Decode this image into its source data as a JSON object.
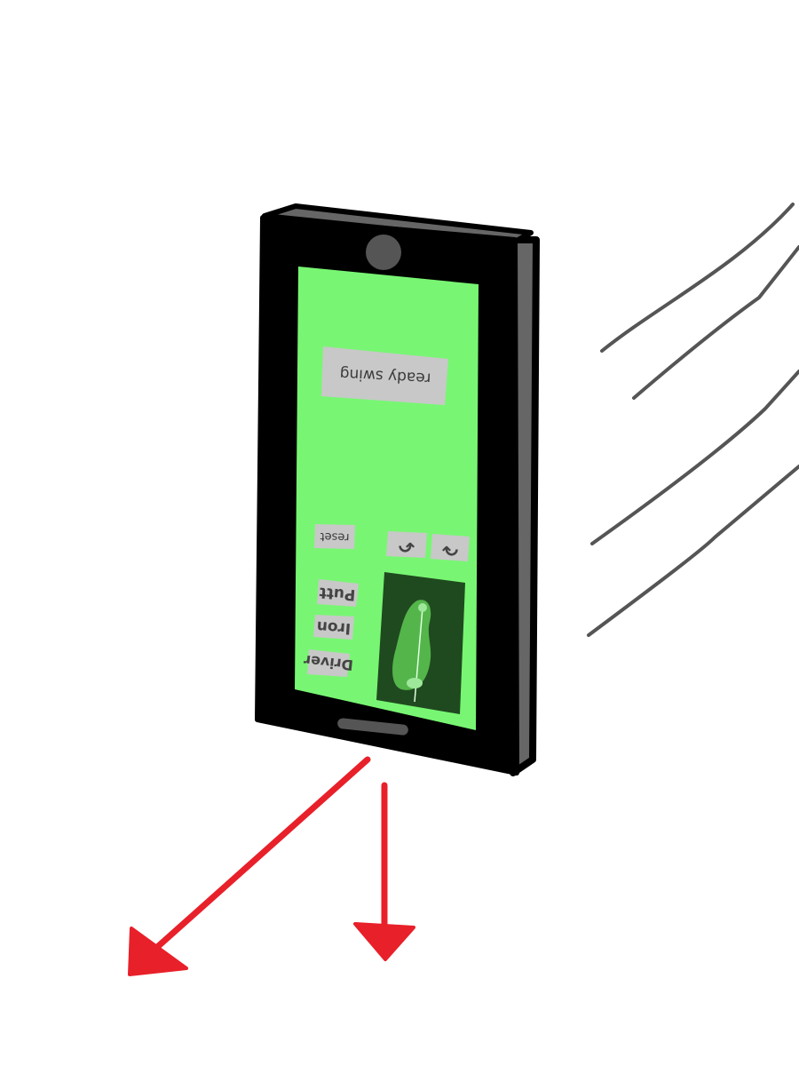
{
  "phone": {
    "screen_color": "#78f673",
    "frame_color": "#000000",
    "side_color": "#666666",
    "camera_color": "#555555"
  },
  "screen": {
    "ready_swing_button": {
      "label": "ready swing"
    },
    "reset_button": {
      "label": "reset"
    },
    "arrow_buttons": [
      {
        "icon": "turn-left-arrow-icon",
        "glyph": "↶"
      },
      {
        "icon": "turn-right-arrow-icon",
        "glyph": "↷"
      }
    ],
    "club_buttons": [
      {
        "label": "Putt"
      },
      {
        "label": "Iron"
      },
      {
        "label": "Driver"
      }
    ],
    "course_map": {
      "bg_color": "#1f4a1f",
      "fairway_color": "#54b54b",
      "green_color": "#9ee89a"
    }
  },
  "annotations": {
    "motion_lines_color": "#555555",
    "arrow_color": "#e8202a"
  }
}
